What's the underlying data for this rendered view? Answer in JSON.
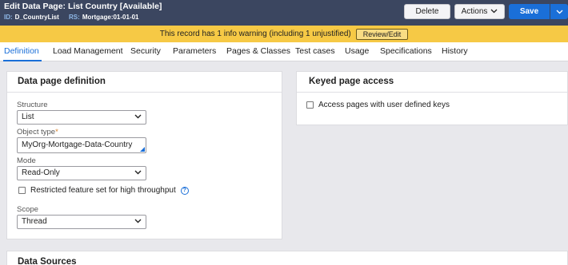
{
  "header": {
    "edit": "Edit",
    "title": "Data Page: List Country [Available]",
    "id_label": "ID:",
    "id_value": "D_CountryList",
    "rs_label": "RS:",
    "rs_value": "Mortgage:01-01-01",
    "delete_label": "Delete",
    "actions_label": "Actions",
    "save_label": "Save"
  },
  "warning": {
    "text": "This record has 1 info warning (including 1 unjustified)",
    "review_label": "Review/Edit"
  },
  "tabs": [
    {
      "label": "Definition"
    },
    {
      "label": "Load Management"
    },
    {
      "label": "Security"
    },
    {
      "label": "Parameters"
    },
    {
      "label": "Pages & Classes"
    },
    {
      "label": "Test cases"
    },
    {
      "label": "Usage"
    },
    {
      "label": "Specifications"
    },
    {
      "label": "History"
    }
  ],
  "definition": {
    "title": "Data page definition",
    "structure_label": "Structure",
    "structure_value": "List",
    "object_type_label": "Object type",
    "object_type_required": "*",
    "object_type_value": "MyOrg-Mortgage-Data-Country",
    "mode_label": "Mode",
    "mode_value": "Read-Only",
    "restricted_label": "Restricted feature set for high throughput",
    "scope_label": "Scope",
    "scope_value": "Thread"
  },
  "keyed": {
    "title": "Keyed page access",
    "access_label": "Access pages with user defined keys"
  },
  "data_sources": {
    "title": "Data Sources"
  }
}
